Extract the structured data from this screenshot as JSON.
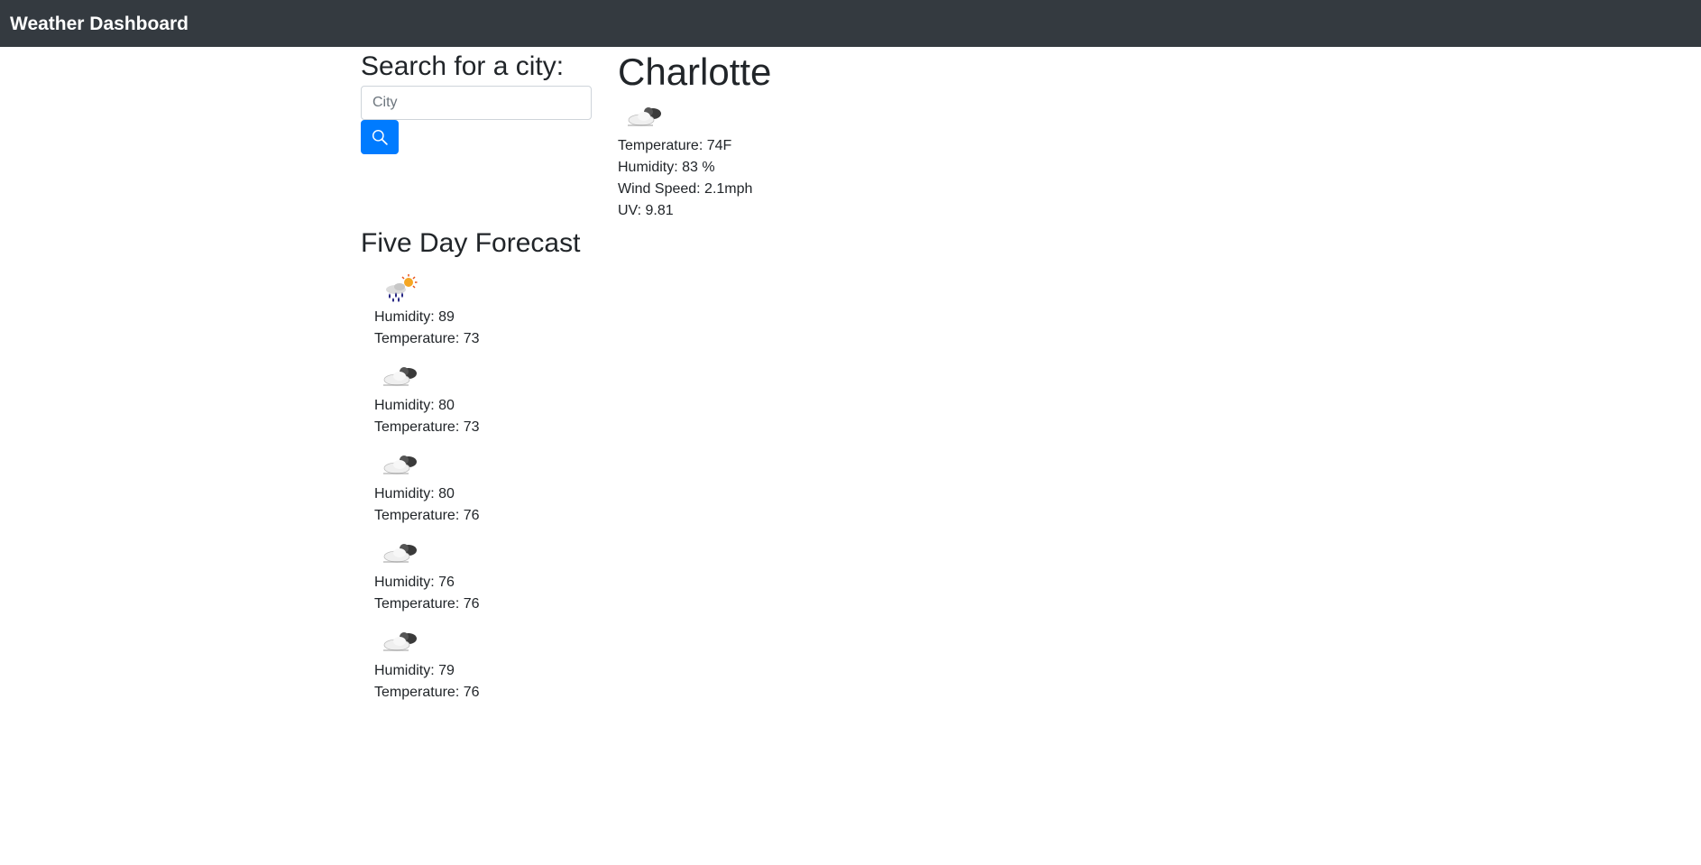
{
  "navbar": {
    "brand": "Weather Dashboard"
  },
  "search": {
    "heading": "Search for a city:",
    "placeholder": "City",
    "button_icon": "search-icon"
  },
  "current": {
    "city": "Charlotte",
    "icon": "broken-clouds-icon",
    "temperature": "Temperature: 74F",
    "humidity": "Humidity: 83 %",
    "wind": "Wind Speed: 2.1mph",
    "uv": "UV: 9.81"
  },
  "forecast": {
    "title": "Five Day Forecast",
    "days": [
      {
        "icon": "rain-sun-icon",
        "humidity": "Humidity: 89",
        "temperature": "Temperature: 73"
      },
      {
        "icon": "broken-clouds-icon",
        "humidity": "Humidity: 80",
        "temperature": "Temperature: 73"
      },
      {
        "icon": "broken-clouds-icon",
        "humidity": "Humidity: 80",
        "temperature": "Temperature: 76"
      },
      {
        "icon": "broken-clouds-icon",
        "humidity": "Humidity: 76",
        "temperature": "Temperature: 76"
      },
      {
        "icon": "broken-clouds-icon",
        "humidity": "Humidity: 79",
        "temperature": "Temperature: 76"
      }
    ]
  },
  "colors": {
    "navbar_bg": "#343a40",
    "primary": "#007bff",
    "text": "#212529"
  }
}
